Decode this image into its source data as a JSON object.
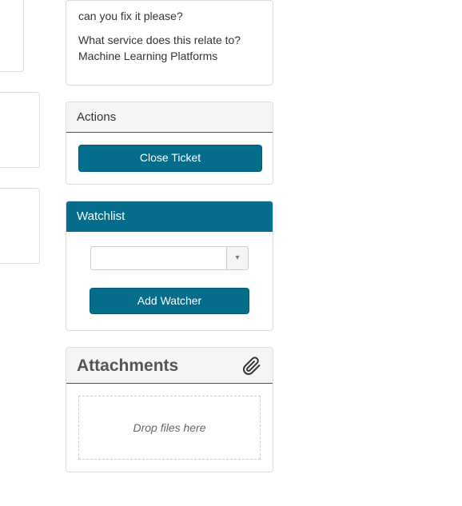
{
  "description": {
    "line1": "can you fix it please?",
    "question": "What service does this relate to?",
    "answer": "Machine Learning Platforms"
  },
  "actions": {
    "heading": "Actions",
    "close_label": "Close Ticket"
  },
  "watchlist": {
    "heading": "Watchlist",
    "input_value": "",
    "caret": "▾",
    "add_label": "Add Watcher"
  },
  "attachments": {
    "heading": "Attachments",
    "dropzone_text": "Drop files here"
  }
}
